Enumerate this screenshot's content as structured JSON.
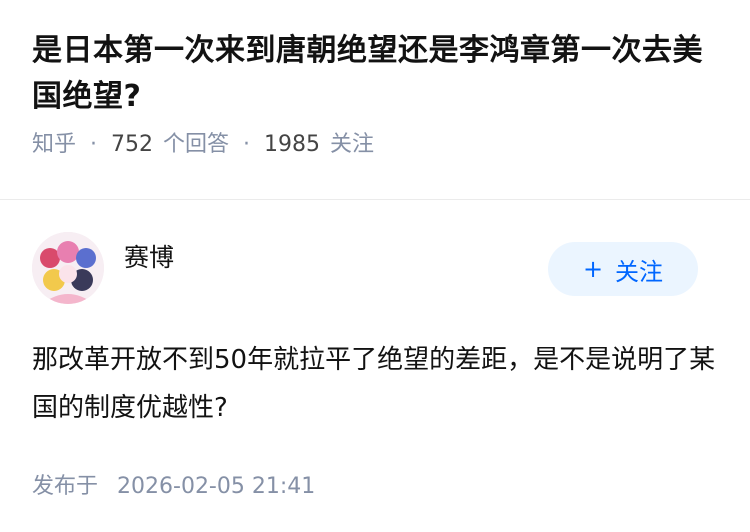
{
  "question": {
    "title": "是日本第一次来到唐朝绝望还是李鸿章第一次去美国绝望?",
    "site": "知乎",
    "answer_count": "752",
    "answer_label": "个回答",
    "follower_count": "1985",
    "follower_label": "关注"
  },
  "answer": {
    "author_name": "赛博",
    "follow_button": "关注",
    "follow_plus": "+",
    "content": "那改革开放不到50年就拉平了绝望的差距，是不是说明了某国的制度优越性?",
    "published_label": "发布于",
    "published_time": "2026-02-05 21:41"
  },
  "colors": {
    "accent": "#0066ff",
    "button_bg": "#ebf5ff",
    "meta_gray": "#8590a6",
    "text": "#121212"
  }
}
